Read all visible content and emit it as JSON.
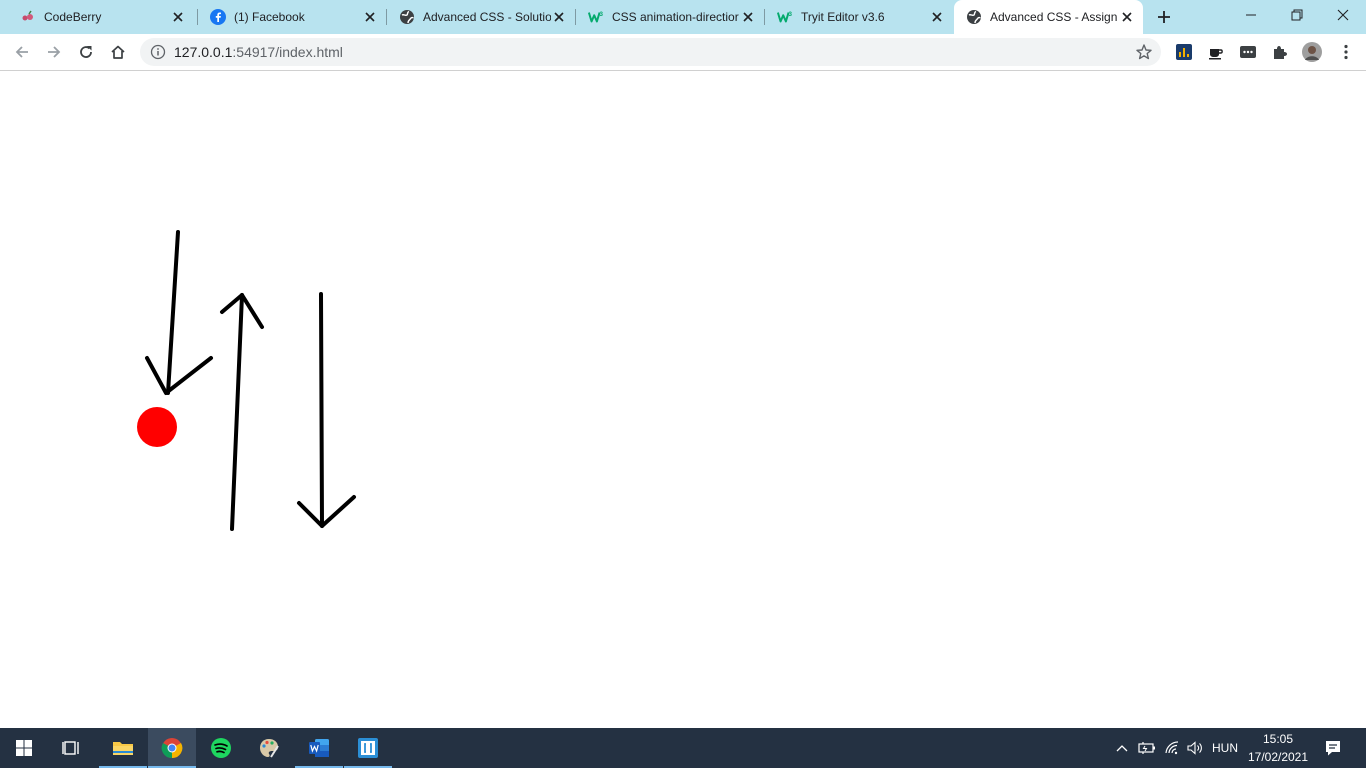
{
  "browser": {
    "tabs": [
      {
        "title": "CodeBerry",
        "icon": "codeberry-icon"
      },
      {
        "title": "(1) Facebook",
        "icon": "facebook-icon"
      },
      {
        "title": "Advanced CSS - Solutio",
        "icon": "globe-icon"
      },
      {
        "title": "CSS animation-directior",
        "icon": "w3schools-icon"
      },
      {
        "title": "Tryit Editor v3.6",
        "icon": "w3schools-icon"
      },
      {
        "title": "Advanced CSS - Assign",
        "icon": "globe-icon",
        "active": true
      }
    ],
    "url_host": "127.0.0.1",
    "url_path": ":54917/index.html"
  },
  "page": {
    "ball_color": "#ff0000"
  },
  "taskbar": {
    "language": "HUN",
    "time": "15:05",
    "date": "17/02/2021"
  }
}
